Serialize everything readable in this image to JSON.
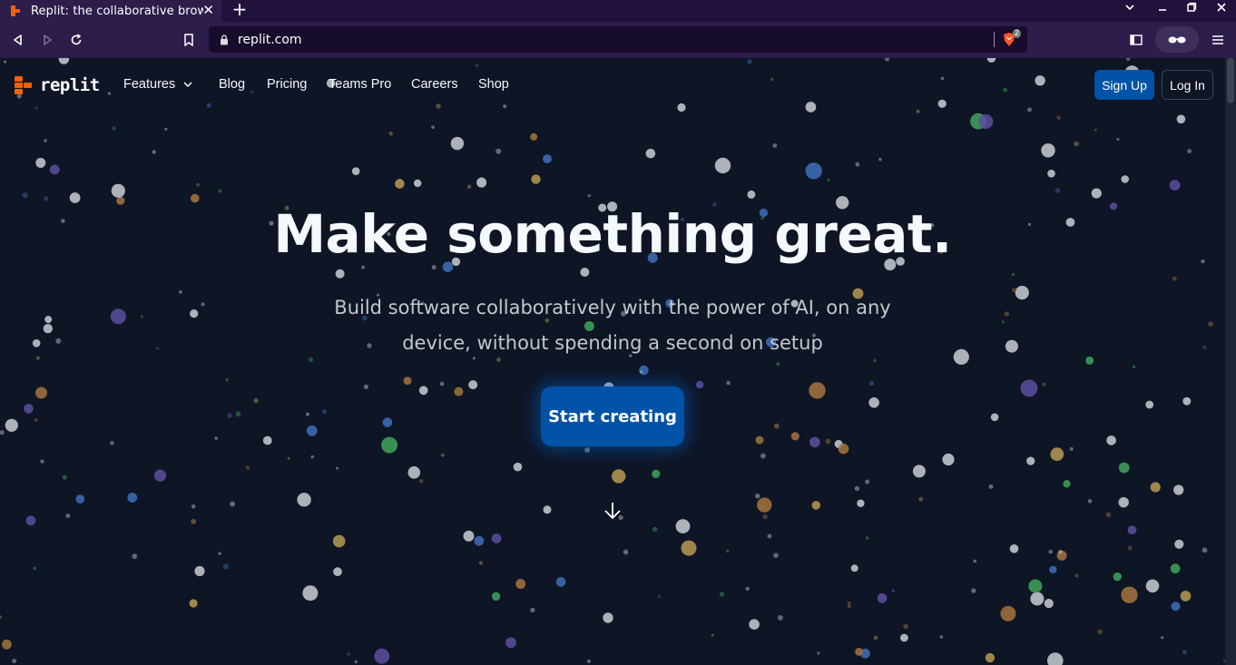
{
  "browser": {
    "tab_title": "Replit: the collaborative browser-based IDE",
    "tab_close": "✕",
    "new_tab": "+",
    "url": "replit.com",
    "shields_count": "2"
  },
  "nav": {
    "logo_text": "replit",
    "links": [
      "Features",
      "Blog",
      "Pricing",
      "Teams Pro",
      "Careers",
      "Shop"
    ],
    "signup": "Sign Up",
    "login": "Log In"
  },
  "hero": {
    "title": "Make something great.",
    "subtitle": "Build software collaboratively with the power of AI, on any device, without spending a second on setup",
    "cta": "Start creating"
  },
  "colors": {
    "background": "#0e1525",
    "accent": "#0053a6",
    "brand_orange": "#f26207"
  },
  "icons": [
    "chevron-down-icon",
    "arrow-down-icon",
    "lock-icon",
    "brave-shield-icon",
    "bookmark-icon",
    "reload-icon",
    "back-icon",
    "forward-icon"
  ]
}
